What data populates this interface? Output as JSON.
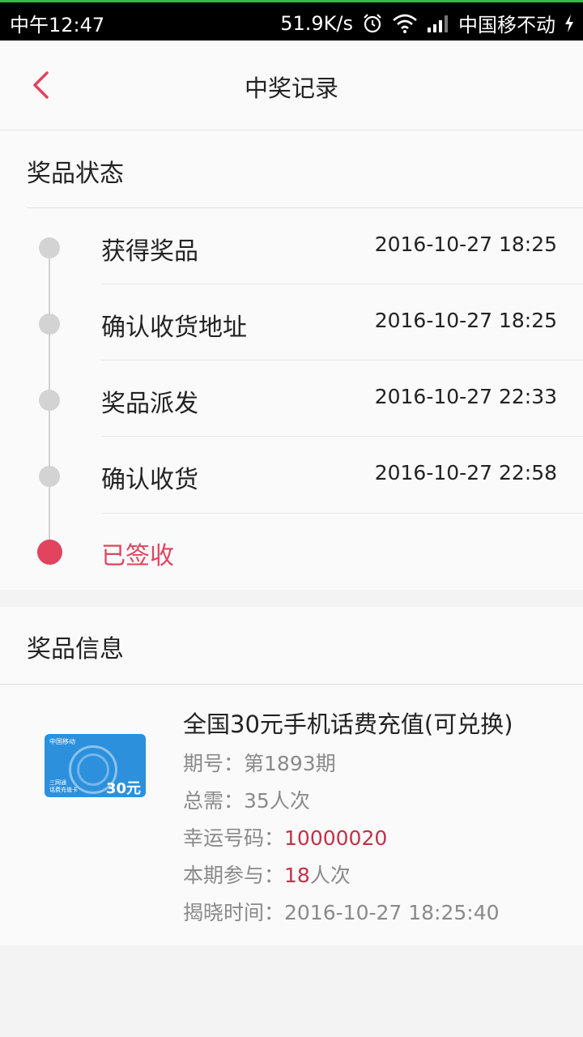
{
  "status_bar": {
    "time": "中午12:47",
    "speed": "51.9K/s",
    "carrier": "中国移不动"
  },
  "header": {
    "title": "中奖记录"
  },
  "prize_status": {
    "title": "奖品状态",
    "steps": [
      {
        "label": "获得奖品",
        "time": "2016-10-27 18:25"
      },
      {
        "label": "确认收货地址",
        "time": "2016-10-27 18:25"
      },
      {
        "label": "奖品派发",
        "time": "2016-10-27 22:33"
      },
      {
        "label": "确认收货",
        "time": "2016-10-27 22:58"
      },
      {
        "label": "已签收",
        "time": ""
      }
    ],
    "active_color": "#e2435f"
  },
  "prize_info": {
    "title": "奖品信息",
    "name": "全国30元手机话费充值(可兑换)",
    "period_label": "期号：",
    "period_value": "第1893期",
    "total_label": "总需：",
    "total_value": "35人次",
    "lucky_label": "幸运号码：",
    "lucky_value": "10000020",
    "join_label": "本期参与：",
    "join_value": "18",
    "join_unit": "人次",
    "reveal_label": "揭晓时间：",
    "reveal_value": "2016-10-27 18:25:40",
    "card": {
      "brand": "中国移动",
      "amount": "30元",
      "caption": "三网通\n话费充值卡"
    }
  }
}
